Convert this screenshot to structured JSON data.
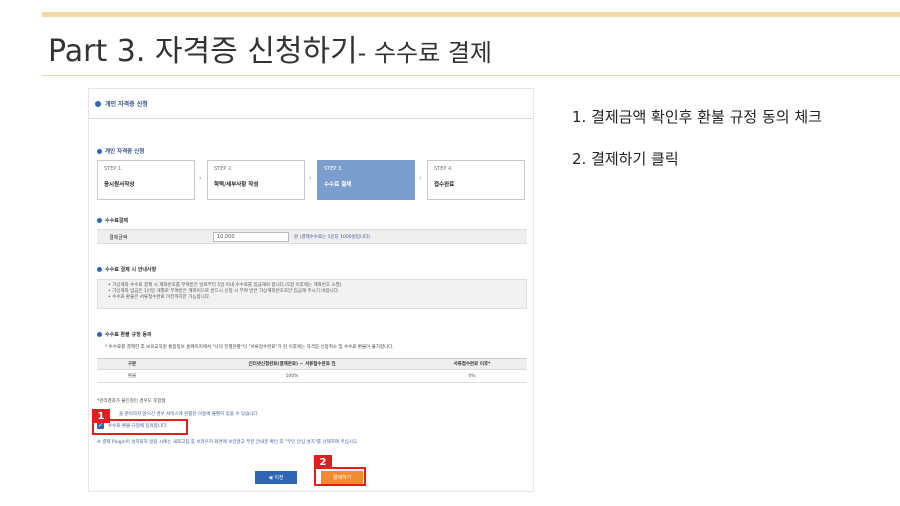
{
  "slide": {
    "title_main": "Part 3. 자격증 신청하기",
    "title_sub": "- 수수료 결제",
    "steps": [
      "1.  결제금액 확인후 환불 규정 동의 체크",
      "2.  결제하기 클릭"
    ]
  },
  "shot": {
    "header": "개인 자격증 신청",
    "section_title": "개인 자격증 신청",
    "step_boxes": [
      {
        "num": "STEP 1.",
        "label": "응시원서작성"
      },
      {
        "num": "STEP 2.",
        "label": "학력/세부사항 작성"
      },
      {
        "num": "STEP 3.",
        "label": "수수료 결제"
      },
      {
        "num": "STEP 4.",
        "label": "접수완료"
      }
    ],
    "fee": {
      "title": "수수료결제",
      "label": "결제금액",
      "value": "10,000",
      "note": "원 (결제수수료는 1인당 1000원입니다)"
    },
    "notice": {
      "title": "수수료 결제 시 안내사항",
      "lines": [
        "• 가상계좌 수수료 결제 시 계좌번호를 부여받은 날로부터 5일 이내 수수료를 입금해야 합니다.(5일 이후에는 계좌번호 소멸)",
        "• 가상계좌 입금은 1인당 개별로 부여받은 계좌이므로 반드시 신청 시 부여 받은 가상계좌번호로만 입금해 주시기 바랍니다.",
        "• 수수료 환불은 서류접수완료 이전까지만 가능합니다."
      ]
    },
    "refund": {
      "title": "수수료 환불 규정 동의",
      "note": "* 수수료를 결제한 후 보육교직원 통합정보 홈페이지에서 \"나의 진행현황\"이 \"서류접수완료\"가 된 이후에는 자격증 신청취소 및 수수료 환불이 불가합니다.",
      "headers": [
        "구분",
        "인터넷신청완료(결제완료) ~ 서류접수완료 전",
        "서류접수완료 이후*"
      ],
      "row": [
        "환불",
        "100%",
        "0%"
      ]
    },
    "exam_note": "*관리결과가 불인정인 경우도 포함됨",
    "info_note": "을 준비하지 않으신 경우 서비스에 원활한 이용에 불편이 있을 수 있습니다.",
    "agree_label": "수수료 환불 규정에 동의합니다.",
    "warn_note": "※ 결제 Plugin이 설치되지 않을 시에는 새로고침 후 브라우저 화면에 보안경고 부분 안내문 확인 후 \"무인 안심 설치\"를 선택하여 주십시오.",
    "btn_prev": "이전",
    "btn_pay": "결제하기"
  },
  "callouts": [
    "1",
    "2"
  ],
  "colors": {
    "accent": "#2e66b5",
    "active_step": "#7c9ecf",
    "pay": "#f08b2e",
    "callout": "#e02020"
  }
}
